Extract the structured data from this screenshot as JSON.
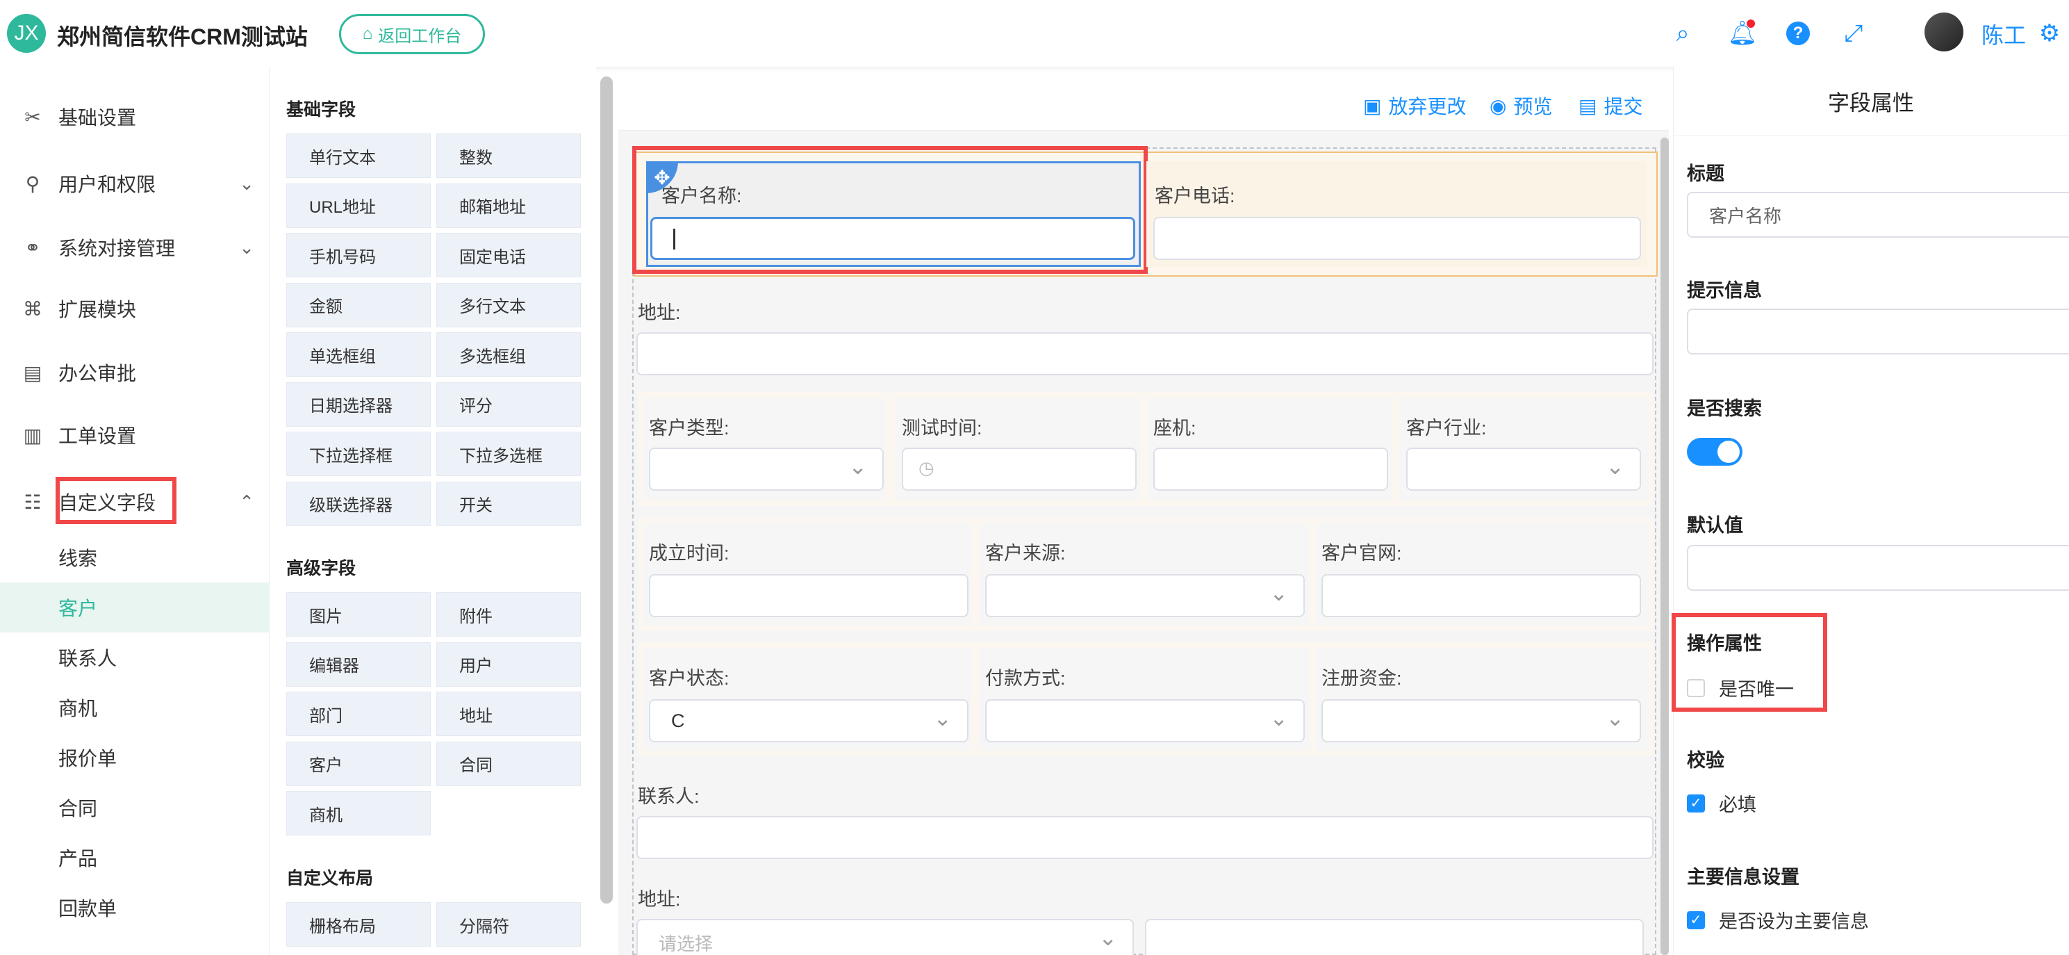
{
  "header": {
    "logo_text": "JX",
    "site_title": "郑州简信软件CRM测试站",
    "back_button": "返回工作台",
    "user_name": "陈工",
    "icons": [
      "search-icon",
      "bell-icon",
      "help-icon",
      "fullscreen-icon",
      "gear-icon"
    ]
  },
  "nav": {
    "items": [
      {
        "label": "基础设置",
        "icon": "tools-icon"
      },
      {
        "label": "用户和权限",
        "icon": "user-key-icon"
      },
      {
        "label": "系统对接管理",
        "icon": "link-icon"
      },
      {
        "label": "扩展模块",
        "icon": "command-icon"
      },
      {
        "label": "办公审批",
        "icon": "approve-icon"
      },
      {
        "label": "工单设置",
        "icon": "clipboard-icon"
      },
      {
        "label": "自定义字段",
        "icon": "grid-icon"
      }
    ],
    "sub_items": [
      "线索",
      "客户",
      "联系人",
      "商机",
      "报价单",
      "合同",
      "产品",
      "回款单"
    ],
    "active_sub": "客户"
  },
  "palette": {
    "basic_title": "基础字段",
    "basic": [
      "单行文本",
      "整数",
      "URL地址",
      "邮箱地址",
      "手机号码",
      "固定电话",
      "金额",
      "多行文本",
      "单选框组",
      "多选框组",
      "日期选择器",
      "评分",
      "下拉选择框",
      "下拉多选框",
      "级联选择器",
      "开关"
    ],
    "advanced_title": "高级字段",
    "advanced": [
      "图片",
      "附件",
      "编辑器",
      "用户",
      "部门",
      "地址",
      "客户",
      "合同",
      "商机"
    ],
    "layout_title": "自定义布局",
    "layout": [
      "栅格布局",
      "分隔符"
    ]
  },
  "toolbar": {
    "discard": "放弃更改",
    "preview": "预览",
    "submit": "提交"
  },
  "form": {
    "customer_name": "客户名称:",
    "customer_phone": "客户电话:",
    "address": "地址:",
    "customer_type": "客户类型:",
    "test_time": "测试时间:",
    "landline": "座机:",
    "industry": "客户行业:",
    "founded": "成立时间:",
    "source": "客户来源:",
    "website": "客户官网:",
    "status": "客户状态:",
    "status_value": "C",
    "payment": "付款方式:",
    "capital": "注册资金:",
    "contact": "联系人:",
    "address2": "地址:",
    "address2_placeholder": "请选择"
  },
  "props": {
    "title": "字段属性",
    "label_title": "标题",
    "label_value": "客户名称",
    "hint_title": "提示信息",
    "search_title": "是否搜索",
    "search_on": true,
    "default_title": "默认值",
    "op_title": "操作属性",
    "unique_label": "是否唯一",
    "unique_checked": false,
    "validate_title": "校验",
    "required_label": "必填",
    "required_checked": true,
    "main_title": "主要信息设置",
    "main_label": "是否设为主要信息",
    "main_checked": true
  },
  "colors": {
    "accent": "#2fb99c",
    "primary": "#1890ff",
    "highlight": "#f04848"
  }
}
